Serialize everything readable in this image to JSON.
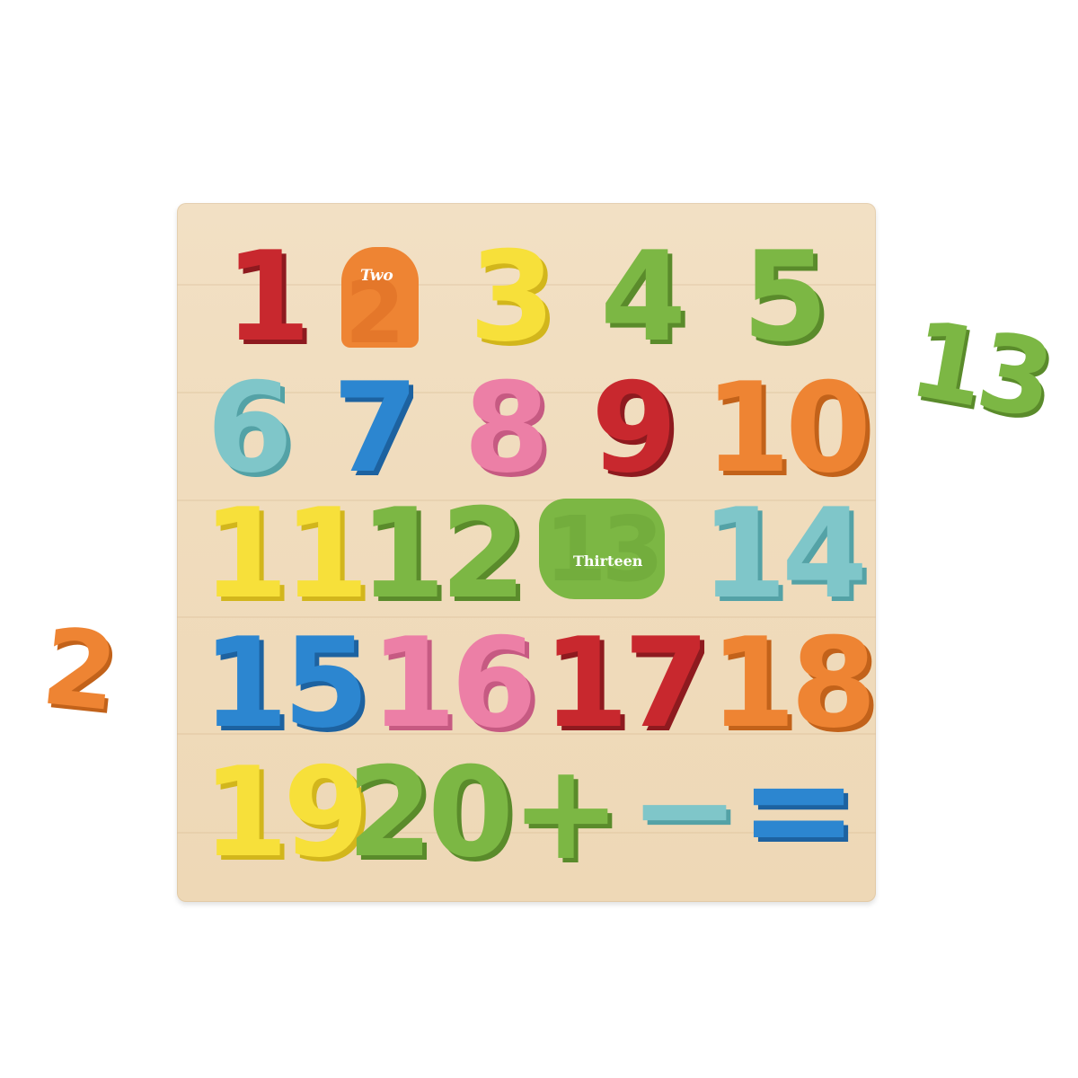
{
  "colors": {
    "background": "#ffffff",
    "board": "#f0dcbd",
    "red": "#c8282e",
    "orange": "#ee8433",
    "yellow": "#f7e03a",
    "green": "#7cb744",
    "teal": "#7fc6c9",
    "blue": "#2c86d0",
    "pink": "#ec7fa6"
  },
  "pieces": {
    "p1": "1",
    "p3": "3",
    "p4": "4",
    "p5": "5",
    "p6": "6",
    "p7": "7",
    "p8": "8",
    "p9": "9",
    "p10": "10",
    "p11": "11",
    "p12": "12",
    "p14": "14",
    "p15": "15",
    "p16": "16",
    "p17": "17",
    "p18": "18",
    "p19": "19",
    "p20": "20",
    "plus": "+",
    "minus": "−",
    "equals": "="
  },
  "slots": {
    "two_label": "Two",
    "thirteen_label": "Thirteen"
  },
  "loose": {
    "two": "2",
    "thirteen": "13"
  }
}
